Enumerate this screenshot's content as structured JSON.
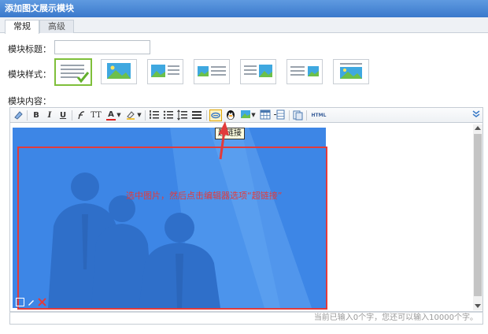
{
  "window": {
    "title": "添加图文展示模块"
  },
  "tabs": [
    {
      "label": "常规"
    },
    {
      "label": "高级"
    }
  ],
  "form": {
    "title_label": "模块标题：",
    "title_value": "",
    "style_label": "模块样式：",
    "style_options": [
      "style-1",
      "style-2",
      "style-3",
      "style-4",
      "style-5",
      "style-6",
      "style-7"
    ],
    "selected_style": 0,
    "content_label": "模块内容："
  },
  "toolbar": {
    "buttons": [
      "eraser-icon",
      "bold-icon",
      "italic-icon",
      "underline-icon",
      "font-family-icon",
      "font-size-icon",
      "font-color-icon",
      "highlight-icon",
      "ordered-list-icon",
      "unordered-list-icon",
      "line-height-icon",
      "align-icon",
      "hyperlink-icon",
      "emoticon-icon",
      "insert-image-icon",
      "table-icon",
      "insert-row-icon",
      "paste-icon",
      "html-source-icon",
      "expand-icon"
    ],
    "bold_label": "B",
    "italic_label": "I",
    "underline_label": "U",
    "font_size_label": "TT",
    "font_color_label": "A",
    "html_label": "HTML",
    "tooltip": "超链接"
  },
  "editor": {
    "annotation": "选中图片，然后点击编辑器选项“超链接”",
    "image_tools": [
      "resize-icon",
      "edit-icon",
      "delete-icon"
    ]
  },
  "status": {
    "text": "当前已输入0个字，您还可以输入10000个字。"
  },
  "colors": {
    "titlebar": "#3a79cc",
    "accent_red": "#e23b3b",
    "selected_border": "#7fbf3a",
    "photo_blue": "#3d86e6"
  }
}
